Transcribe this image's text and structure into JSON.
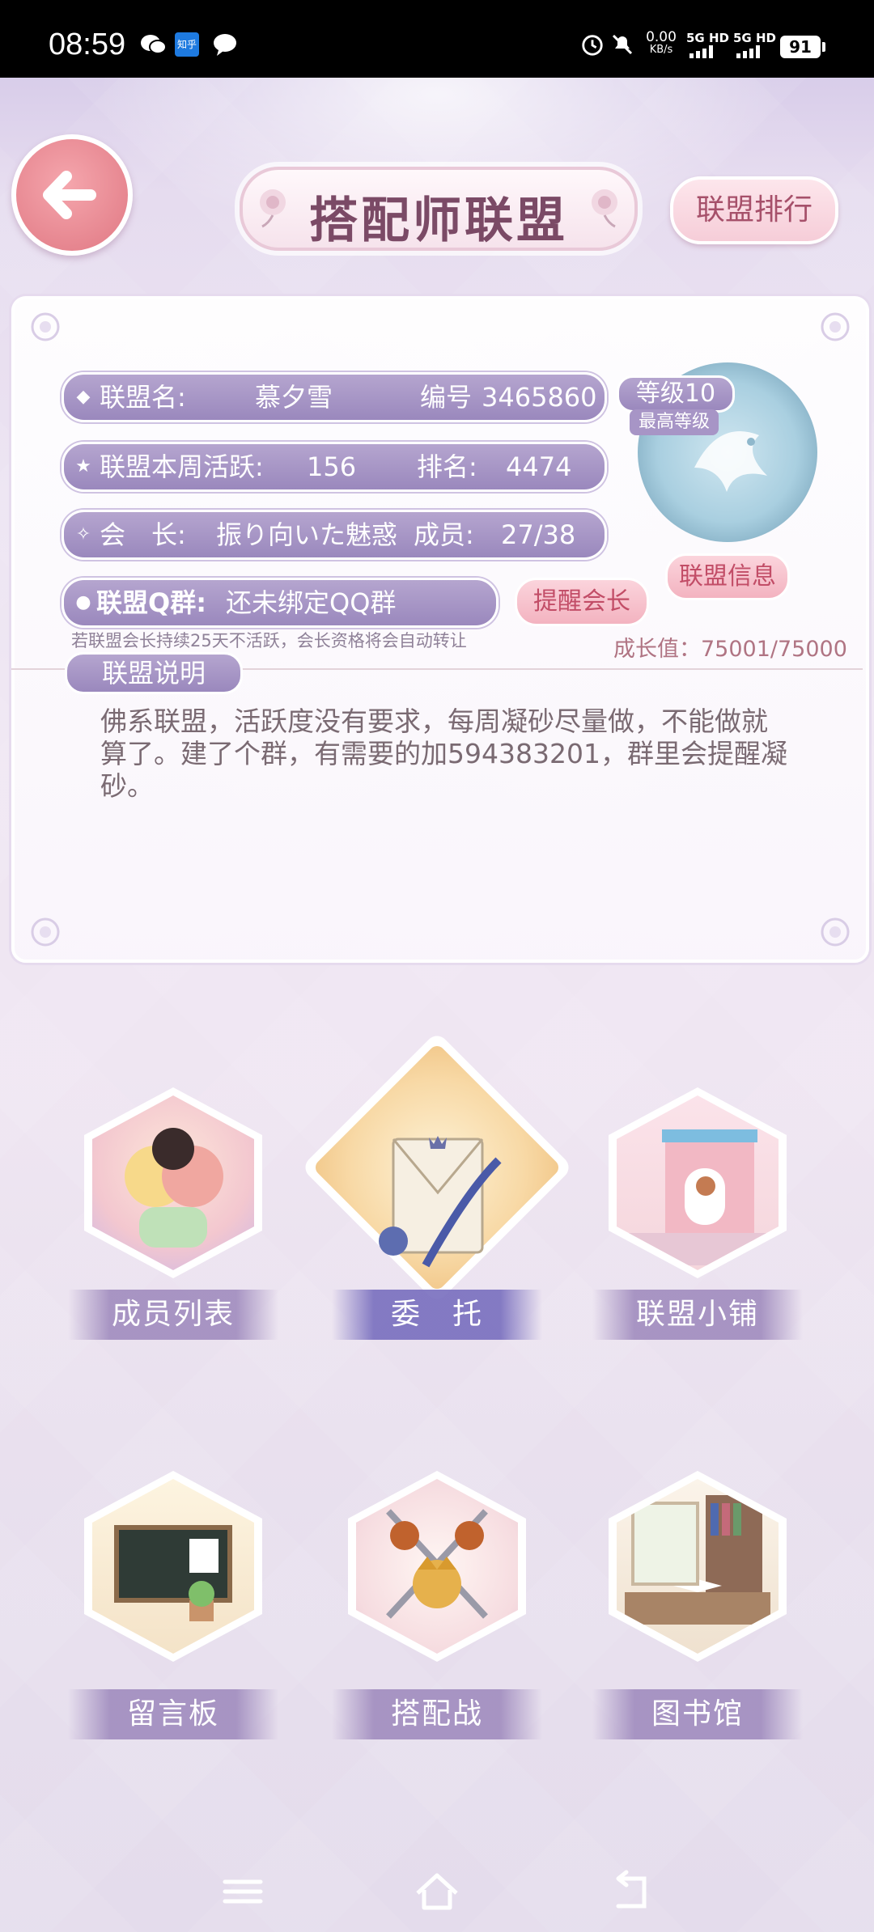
{
  "status_bar": {
    "time": "08:59",
    "app_icons": [
      "wechat-icon",
      "zhihu-icon",
      "message-icon"
    ],
    "zhihu_label": "知乎",
    "net_speed": "0.00",
    "net_unit": "KB/s",
    "signal1": "5G HD",
    "signal2": "5G HD",
    "battery": "91"
  },
  "header": {
    "title": "搭配师联盟",
    "rank_button": "联盟排行"
  },
  "alliance": {
    "name_label": "联盟名:",
    "name": "慕夕雪",
    "id_label": "编号",
    "id": "3465860",
    "activity_label": "联盟本周活跃:",
    "activity": "156",
    "rank_label": "排名:",
    "rank": "4474",
    "leader_label": "会　长:",
    "leader": "振り向いた魅惑",
    "members_label": "成员:",
    "members": "27/38",
    "qq_label": "联盟Q群:",
    "qq_value": "还未绑定QQ群",
    "remind_button": "提醒会长",
    "level": "等级10",
    "level_sub": "最高等级",
    "info_button": "联盟信息",
    "hint": "若联盟会长持续25天不活跃，会长资格将会自动转让",
    "growth": "成长值：75001/75000",
    "accent": "#9a88bd"
  },
  "description": {
    "title": "联盟说明",
    "text": "佛系联盟，活跃度没有要求，每周凝砂尽量做，不能做就算了。建了个群，有需要的加594383201，群里会提醒凝砂。"
  },
  "menu": [
    {
      "label": "成员列表",
      "icon": "members-icon"
    },
    {
      "label": "委　托",
      "icon": "commission-letter-icon"
    },
    {
      "label": "联盟小铺",
      "icon": "shop-icon"
    },
    {
      "label": "留言板",
      "icon": "message-board-icon"
    },
    {
      "label": "搭配战",
      "icon": "battle-crest-icon"
    },
    {
      "label": "图书馆",
      "icon": "library-icon"
    }
  ],
  "navbar": {
    "icons": [
      "menu-icon",
      "home-icon",
      "back-icon"
    ]
  }
}
